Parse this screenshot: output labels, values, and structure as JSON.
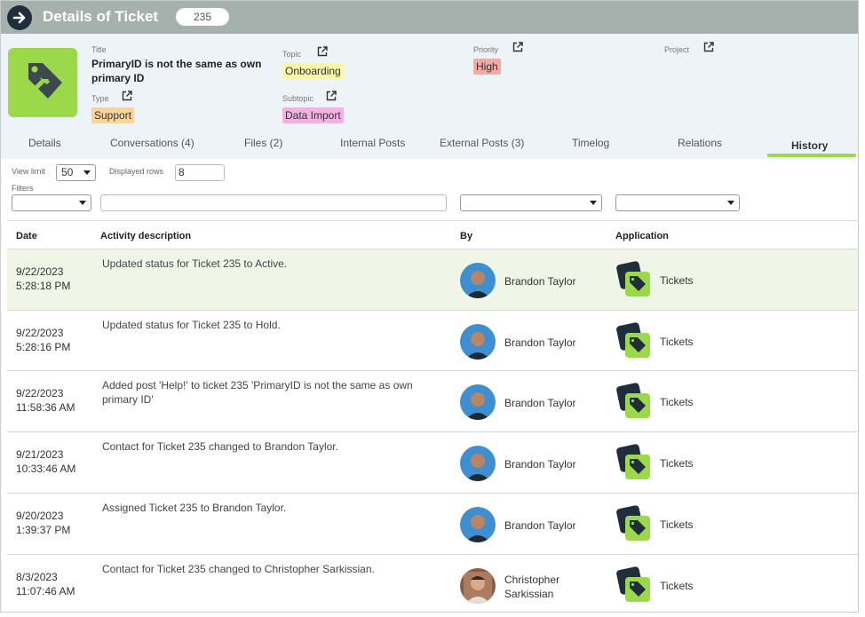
{
  "header": {
    "title": "Details of Ticket",
    "ticket_number": "235"
  },
  "info": {
    "title_label": "Title",
    "title_value": "PrimaryID is not the same as own primary ID",
    "type_label": "Type",
    "type_value": "Support",
    "topic_label": "Topic",
    "topic_value": "Onboarding",
    "subtopic_label": "Subtopic",
    "subtopic_value": "Data Import",
    "priority_label": "Priority",
    "priority_value": "High",
    "project_label": "Project"
  },
  "tabs": [
    {
      "label": "Details"
    },
    {
      "label": "Conversations (4)"
    },
    {
      "label": "Files (2)"
    },
    {
      "label": "Internal Posts"
    },
    {
      "label": "External Posts (3)"
    },
    {
      "label": "Timelog"
    },
    {
      "label": "Relations"
    },
    {
      "label": "History"
    }
  ],
  "active_tab": "History",
  "controls": {
    "view_limit_label": "View limit",
    "view_limit_value": "50",
    "displayed_rows_label": "Displayed rows",
    "displayed_rows_value": "8",
    "filters_label": "Filters"
  },
  "table": {
    "columns": [
      "Date",
      "Activity description",
      "By",
      "Application"
    ],
    "rows": [
      {
        "date": "9/22/2023",
        "time": "5:28:18 PM",
        "description": "Updated status for Ticket 235 to Active.",
        "by1": "Brandon Taylor",
        "by2": "",
        "app": "Tickets"
      },
      {
        "date": "9/22/2023",
        "time": "5:28:16 PM",
        "description": "Updated status for Ticket 235 to Hold.",
        "by1": "Brandon Taylor",
        "by2": "",
        "app": "Tickets"
      },
      {
        "date": "9/22/2023",
        "time": "11:58:36 AM",
        "description": "Added post 'Help!' to ticket 235 'PrimaryID is not the same as own primary ID'",
        "by1": "Brandon Taylor",
        "by2": "",
        "app": "Tickets"
      },
      {
        "date": "9/21/2023",
        "time": "10:33:46 AM",
        "description": "Contact for Ticket 235 changed to Brandon Taylor.",
        "by1": "Brandon Taylor",
        "by2": "",
        "app": "Tickets"
      },
      {
        "date": "9/20/2023",
        "time": "1:39:37 PM",
        "description": "Assigned Ticket 235 to Brandon Taylor.",
        "by1": "Brandon Taylor",
        "by2": "",
        "app": "Tickets"
      },
      {
        "date": "8/3/2023",
        "time": "11:07:46 AM",
        "description": "Contact for Ticket 235 changed to Christopher Sarkissian.",
        "by1": "Christopher",
        "by2": "Sarkissian",
        "app": "Tickets"
      }
    ]
  },
  "colors": {
    "header_bg": "#a6b1ad",
    "accent_green": "#9cd94a",
    "tag_support": "#fbd49a",
    "tag_onboarding": "#fbf5a8",
    "tag_data_import": "#f6b0e4",
    "tag_high": "#f4a9a4",
    "selected_row": "#eff6e8"
  }
}
